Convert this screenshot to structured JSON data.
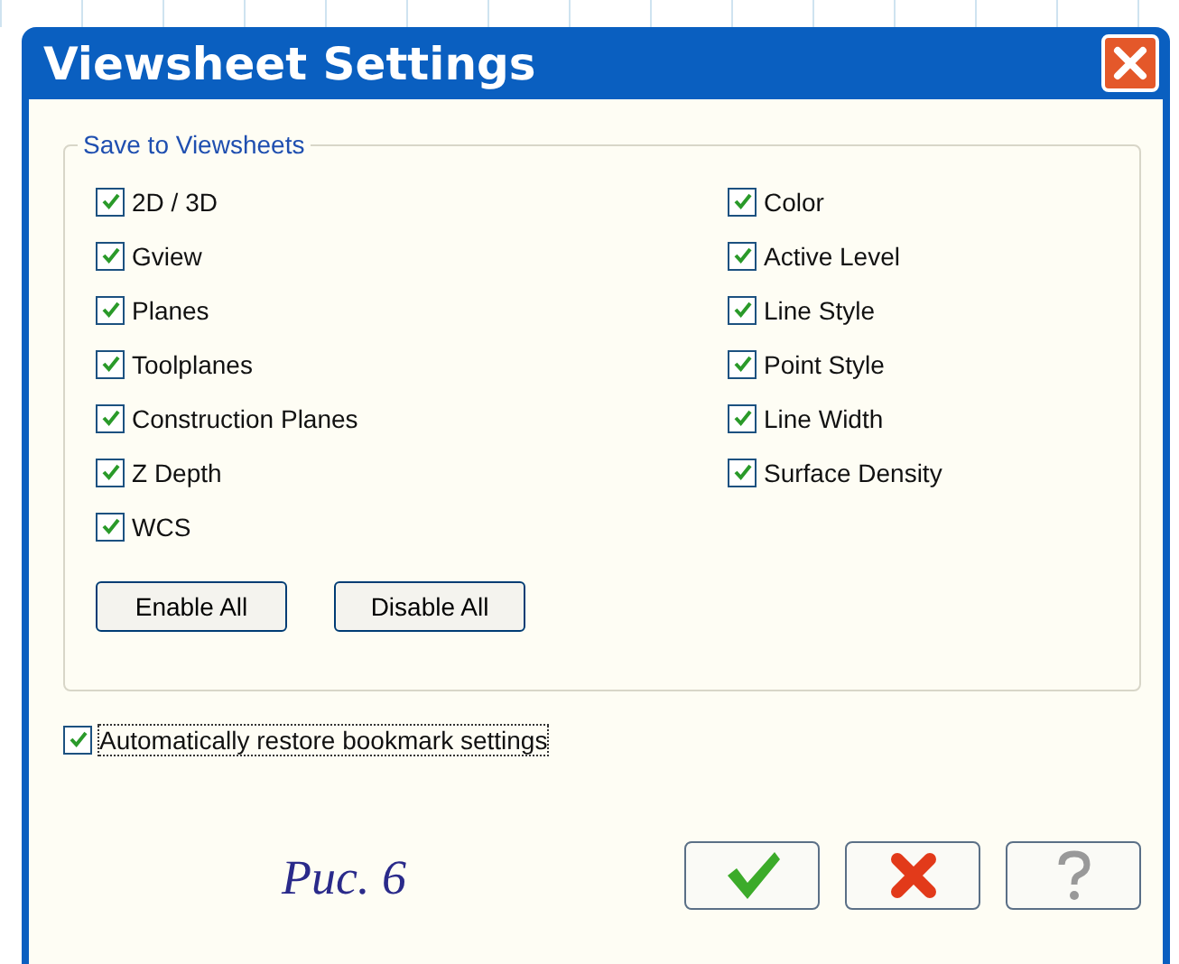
{
  "window": {
    "title": "Viewsheet Settings"
  },
  "group": {
    "title": "Save to Viewsheets",
    "left": [
      {
        "label": "2D / 3D",
        "checked": true
      },
      {
        "label": "Gview",
        "checked": true
      },
      {
        "label": "Planes",
        "checked": true
      },
      {
        "label": "Toolplanes",
        "checked": true
      },
      {
        "label": "Construction Planes",
        "checked": true
      },
      {
        "label": "Z Depth",
        "checked": true
      },
      {
        "label": "WCS",
        "checked": true
      }
    ],
    "right": [
      {
        "label": "Color",
        "checked": true
      },
      {
        "label": "Active Level",
        "checked": true
      },
      {
        "label": "Line Style",
        "checked": true
      },
      {
        "label": "Point Style",
        "checked": true
      },
      {
        "label": "Line Width",
        "checked": true
      },
      {
        "label": "Surface Density",
        "checked": true
      }
    ],
    "buttons": [
      "Enable All",
      "Disable All"
    ]
  },
  "auto_restore": {
    "label": "Automatically restore bookmark settings",
    "checked": true
  },
  "caption": "Рис. 6"
}
